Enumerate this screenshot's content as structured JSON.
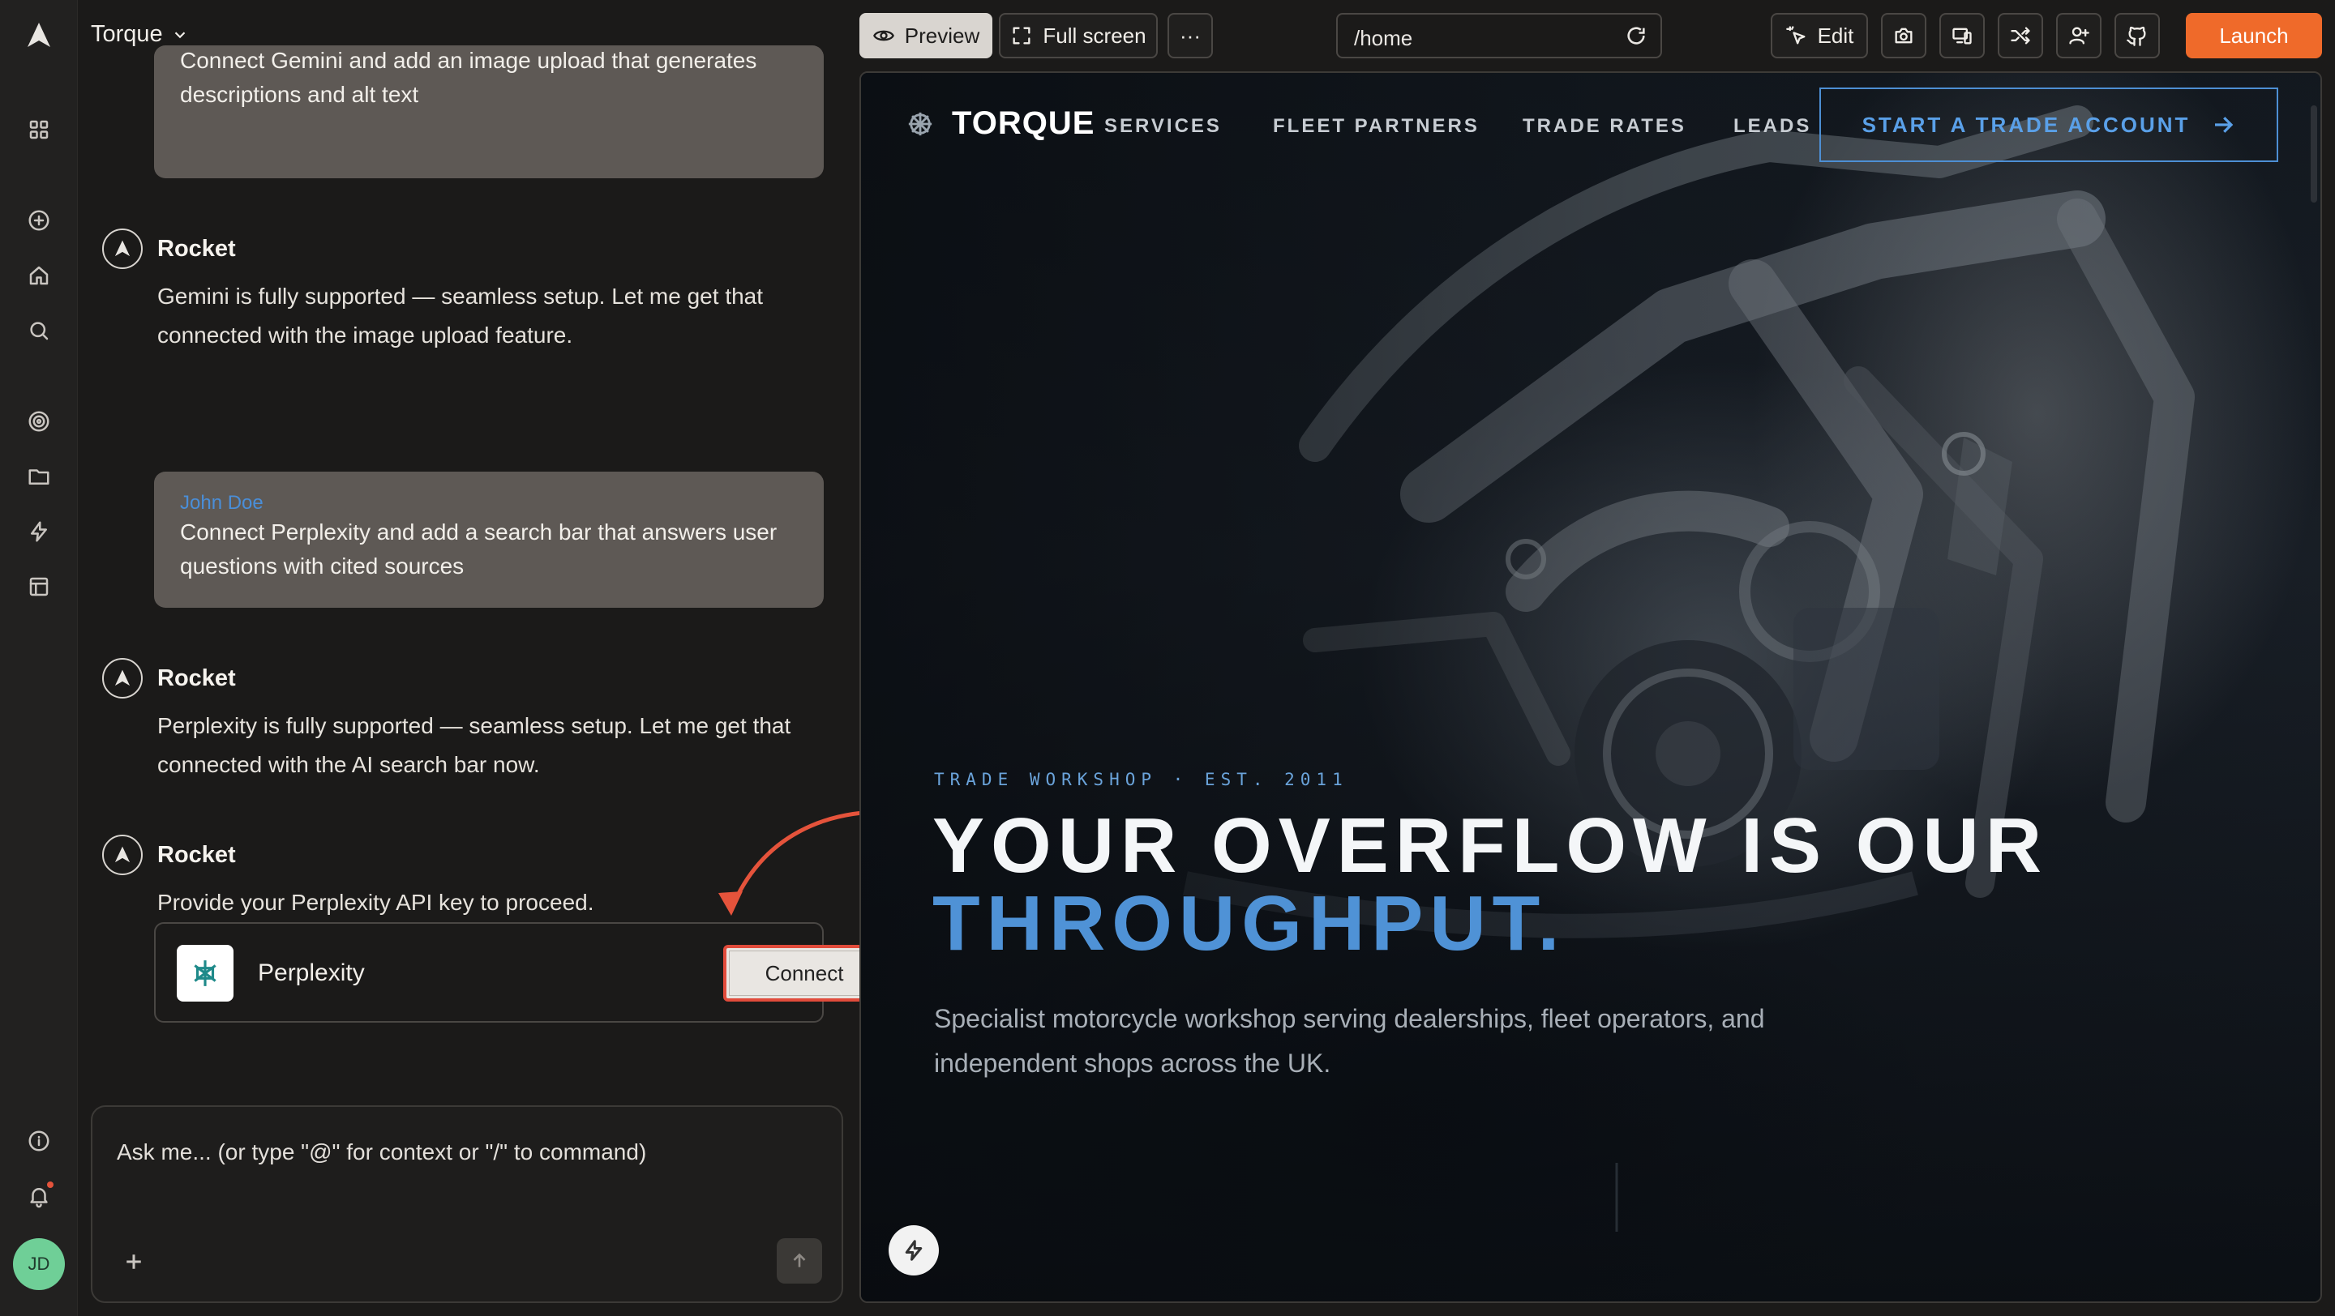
{
  "app": {
    "project_name": "Torque"
  },
  "rail": {
    "icons": [
      "rocket-logo",
      "grid",
      "plus-circle",
      "home",
      "search",
      "target",
      "folder",
      "bolt",
      "layout",
      "info",
      "bell"
    ],
    "avatar_initials": "JD"
  },
  "chat": {
    "messages": [
      {
        "type": "user",
        "text": "Connect Gemini and add an image upload that generates descriptions and alt text"
      },
      {
        "type": "assistant",
        "author": "Rocket",
        "text": "Gemini is fully supported — seamless setup. Let me get that connected with the image upload feature."
      },
      {
        "type": "user",
        "author": "John Doe",
        "text": "Connect Perplexity and add a search bar that answers user questions with cited sources"
      },
      {
        "type": "assistant",
        "author": "Rocket",
        "text": "Perplexity is fully supported — seamless setup. Let me get that connected with the AI search bar now."
      },
      {
        "type": "assistant",
        "author": "Rocket",
        "text": "Provide your Perplexity API key to proceed."
      }
    ],
    "connect_card": {
      "service": "Perplexity",
      "button_label": "Connect"
    },
    "input": {
      "placeholder": "Ask me... (or type \"@\" for context or \"/\" to command)"
    }
  },
  "toolbar": {
    "preview_label": "Preview",
    "fullscreen_label": "Full screen",
    "more_label": "···",
    "url": "/home",
    "edit_label": "Edit",
    "launch_label": "Launch",
    "launch_color": "#ef6a2a"
  },
  "site": {
    "logo": "TORQUE",
    "nav": [
      "SERVICES",
      "FLEET PARTNERS",
      "TRADE RATES",
      "LEADS"
    ],
    "cta": "START A TRADE ACCOUNT",
    "eyebrow": "TRADE WORKSHOP · EST. 2011",
    "headline_line1": "YOUR OVERFLOW IS OUR",
    "headline_line2": "THROUGHPUT.",
    "subtext": "Specialist motorcycle workshop serving dealerships, fleet operators, and independent shops across the UK.",
    "accent_color": "#4f92d6"
  }
}
